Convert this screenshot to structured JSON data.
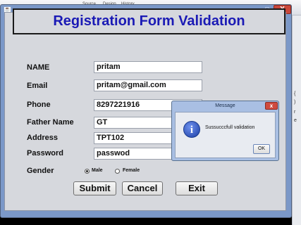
{
  "ide": {
    "tabs": [
      "Source",
      "Design",
      "History"
    ],
    "side_marks": [
      "{",
      ")",
      "r",
      "e"
    ]
  },
  "window": {
    "app_icon": "java-icon",
    "minimize": "_",
    "maximize": "□",
    "close": "X"
  },
  "form": {
    "title": "Registration Form Validation",
    "fields": [
      {
        "label": "NAME",
        "value": "pritam"
      },
      {
        "label": "Email",
        "value": "pritam@gmail.com"
      },
      {
        "label": "Phone",
        "value": "8297221916"
      },
      {
        "label": "Father Name",
        "value": "GT"
      },
      {
        "label": "Address",
        "value": "TPT102"
      },
      {
        "label": "Password",
        "value": "passwod"
      }
    ],
    "gender": {
      "label": "Gender",
      "options": [
        "Male",
        "Female"
      ],
      "selected": "Male"
    },
    "buttons": {
      "submit": "Submit",
      "cancel": "Cancel",
      "exit": "Exit"
    }
  },
  "dialog": {
    "title": "Message",
    "close": "x",
    "icon": "info-icon",
    "icon_glyph": "i",
    "message": "Sussucccfull validation",
    "ok": "OK"
  },
  "colors": {
    "title_text": "#1a1ab5",
    "window_frame": "#7b98c8",
    "close_button": "#c9473a"
  }
}
